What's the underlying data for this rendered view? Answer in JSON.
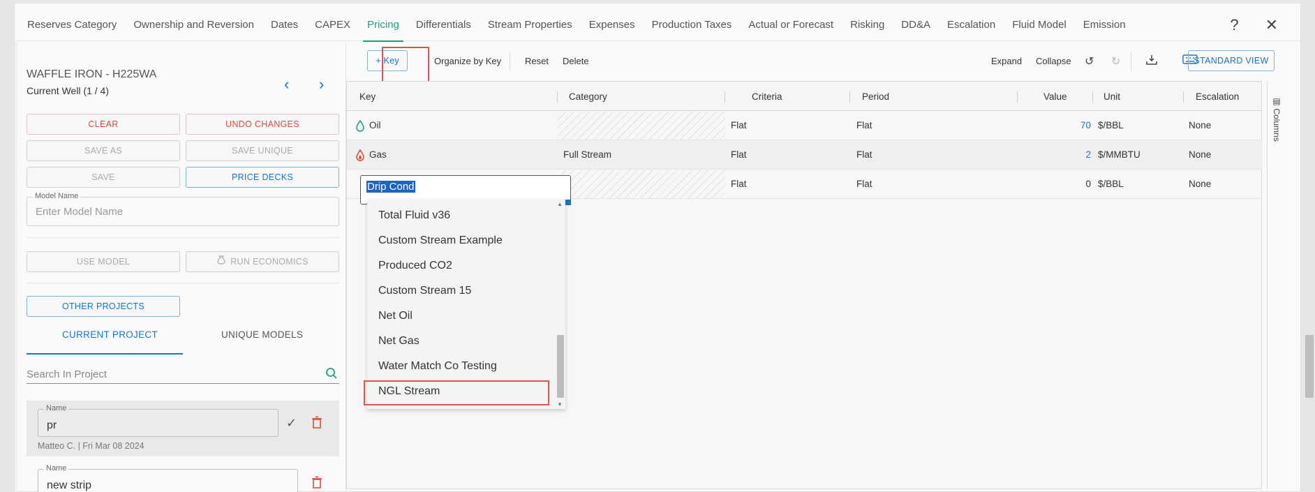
{
  "tabs": [
    {
      "label": "Reserves Category"
    },
    {
      "label": "Ownership and Reversion"
    },
    {
      "label": "Dates"
    },
    {
      "label": "CAPEX"
    },
    {
      "label": "Pricing"
    },
    {
      "label": "Differentials"
    },
    {
      "label": "Stream Properties"
    },
    {
      "label": "Expenses"
    },
    {
      "label": "Production Taxes"
    },
    {
      "label": "Actual or Forecast"
    },
    {
      "label": "Risking"
    },
    {
      "label": "DD&A"
    },
    {
      "label": "Escalation"
    },
    {
      "label": "Fluid Model"
    },
    {
      "label": "Emission"
    }
  ],
  "active_tab": "Pricing",
  "header_icons": {
    "help": "?",
    "close": "✕"
  },
  "left": {
    "well_title": "WAFFLE IRON - H225WA",
    "well_sub": "Current Well (1 / 4)",
    "clear": "CLEAR",
    "undo": "UNDO CHANGES",
    "save_as": "SAVE AS",
    "save_unique": "SAVE UNIQUE",
    "save": "SAVE",
    "price_decks": "PRICE DECKS",
    "model_name_label": "Model Name",
    "model_name_placeholder": "Enter Model Name",
    "use_model": "USE MODEL",
    "run_economics": "RUN ECONOMICS",
    "other_projects": "OTHER PROJECTS",
    "current_project": "CURRENT PROJECT",
    "unique_models": "UNIQUE MODELS",
    "search_placeholder": "Search In Project",
    "models": [
      {
        "label": "Name",
        "value": "pr",
        "meta": "Matteo C. | Fri Mar 08 2024"
      },
      {
        "label": "Name",
        "value": "new strip"
      }
    ]
  },
  "toolbar": {
    "key": "Key",
    "organize": "Organize by Key",
    "reset": "Reset",
    "delete": "Delete",
    "expand": "Expand",
    "collapse": "Collapse",
    "standard_view": "STANDARD VIEW"
  },
  "grid": {
    "headers": [
      "Key",
      "Category",
      "Criteria",
      "Period",
      "Value",
      "Unit",
      "Escalation"
    ],
    "rows": [
      {
        "key": "Oil",
        "category": "",
        "criteria": "Flat",
        "period": "Flat",
        "value": "70",
        "unit": "$/BBL",
        "escalation": "None"
      },
      {
        "key": "Gas",
        "category": "Full Stream",
        "criteria": "Flat",
        "period": "Flat",
        "value": "2",
        "unit": "$/MMBTU",
        "escalation": "None"
      },
      {
        "key": "Drip Cond",
        "category": "",
        "criteria": "Flat",
        "period": "Flat",
        "value": "0",
        "unit": "$/BBL",
        "escalation": "None"
      }
    ],
    "columns_label": "Columns"
  },
  "editor": {
    "value": "Drip Cond",
    "options": [
      "Total Fluid v36",
      "Custom Stream Example",
      "Produced CO2",
      "Custom Stream 15",
      "Net Oil",
      "Net Gas",
      "Water Match Co Testing",
      "NGL Stream"
    ]
  },
  "colors": {
    "accent_green": "#1aa37a",
    "accent_blue": "#1a73c9",
    "danger": "#e0493a",
    "highlight": "#e05252"
  }
}
